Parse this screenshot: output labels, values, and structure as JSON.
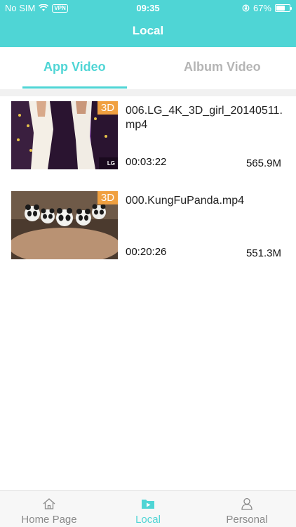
{
  "status_bar": {
    "carrier": "No SIM",
    "vpn": "VPN",
    "time": "09:35",
    "battery": "67%",
    "battery_level": 0.67
  },
  "header": {
    "title": "Local"
  },
  "tabs": [
    {
      "label": "App Video",
      "active": true
    },
    {
      "label": "Album Video",
      "active": false
    }
  ],
  "videos": [
    {
      "name": "006.LG_4K_3D_girl_20140511.mp4",
      "badge": "3D",
      "duration": "00:03:22",
      "size": "565.9M",
      "watermark": "LG"
    },
    {
      "name": "000.KungFuPanda.mp4",
      "badge": "3D",
      "duration": "00:20:26",
      "size": "551.3M"
    }
  ],
  "bottom_nav": [
    {
      "label": "Home Page",
      "icon": "home-icon",
      "active": false
    },
    {
      "label": "Local",
      "icon": "video-folder-icon",
      "active": true
    },
    {
      "label": "Personal",
      "icon": "person-icon",
      "active": false
    }
  ],
  "colors": {
    "accent": "#4fd5d5",
    "badge": "#f0a040",
    "inactive_tab": "#b5b5b5"
  }
}
